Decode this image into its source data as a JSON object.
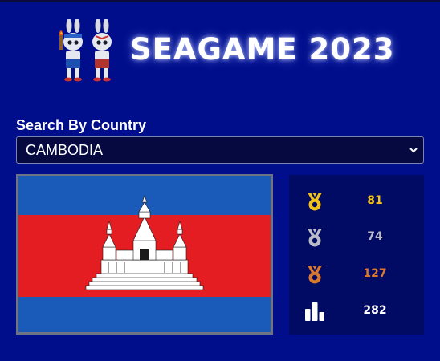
{
  "header": {
    "title": "SEAGAME 2023",
    "mascot_icon": "mascot-rabbits-icon"
  },
  "search": {
    "label": "Search By Country",
    "selected": "CAMBODIA"
  },
  "flag": {
    "country": "CAMBODIA",
    "colors": {
      "blue": "#1a5ab8",
      "red": "#e41d22",
      "white": "#ffffff"
    }
  },
  "medals": {
    "gold": {
      "value": "81",
      "color": "#f2c21a",
      "icon": "gold-medal-icon"
    },
    "silver": {
      "value": "74",
      "color": "#b9bcc8",
      "icon": "silver-medal-icon"
    },
    "bronze": {
      "value": "127",
      "color": "#d9782e",
      "icon": "bronze-medal-icon"
    },
    "total": {
      "value": "282",
      "color": "#ffffff",
      "icon": "podium-icon"
    }
  }
}
